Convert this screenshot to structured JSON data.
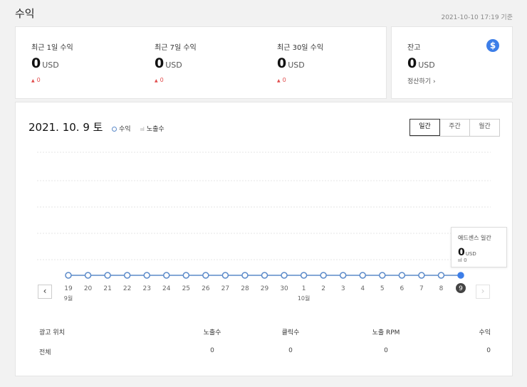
{
  "page": {
    "title": "수익",
    "timestamp": "2021-10-10 17:19 기준"
  },
  "summary": {
    "metrics": [
      {
        "label": "최근 1일 수익",
        "value": "0",
        "unit": "USD",
        "change": "0"
      },
      {
        "label": "최근 7일 수익",
        "value": "0",
        "unit": "USD",
        "change": "0"
      },
      {
        "label": "최근 30일 수익",
        "value": "0",
        "unit": "USD",
        "change": "0"
      }
    ]
  },
  "balance": {
    "label": "잔고",
    "value": "0",
    "unit": "USD",
    "link": "정산하기",
    "link_arrow": "›",
    "icon": "dollar-icon",
    "icon_glyph": "$"
  },
  "chart_panel": {
    "date": "2021. 10. 9 토",
    "legend": {
      "revenue": "수익",
      "impressions": "노출수",
      "impressions_glyph": "ııl"
    },
    "tabs": [
      {
        "label": "일간",
        "active": true
      },
      {
        "label": "주간",
        "active": false
      },
      {
        "label": "월간",
        "active": false
      }
    ],
    "prev_glyph": "‹",
    "next_glyph": "›",
    "tooltip": {
      "title": "애드센스 일간",
      "value": "0",
      "unit": "USD",
      "sub_glyph": "ııl",
      "sub_value": "0"
    }
  },
  "chart_data": {
    "type": "line",
    "x": [
      "19",
      "20",
      "21",
      "22",
      "23",
      "24",
      "25",
      "26",
      "27",
      "28",
      "29",
      "30",
      "1",
      "2",
      "3",
      "4",
      "5",
      "6",
      "7",
      "8",
      "9"
    ],
    "month_labels": [
      {
        "at_index": 0,
        "label": "9월"
      },
      {
        "at_index": 12,
        "label": "10월"
      }
    ],
    "series": [
      {
        "name": "수익",
        "values": [
          0,
          0,
          0,
          0,
          0,
          0,
          0,
          0,
          0,
          0,
          0,
          0,
          0,
          0,
          0,
          0,
          0,
          0,
          0,
          0,
          0
        ]
      }
    ],
    "selected_index": 20,
    "grid": true,
    "colors": {
      "line": "#5b8ac9",
      "selected_point": "#3d7ee8",
      "selected_label_bg": "#444444"
    }
  },
  "table": {
    "headers": [
      "광고 위치",
      "노출수",
      "클릭수",
      "노출 RPM",
      "수익"
    ],
    "rows": [
      [
        "전체",
        "0",
        "0",
        "0",
        "0"
      ]
    ]
  },
  "colors": {
    "accent": "#3d7ee8",
    "positive_change": "#e14b4b",
    "background": "#f2f2f2"
  }
}
